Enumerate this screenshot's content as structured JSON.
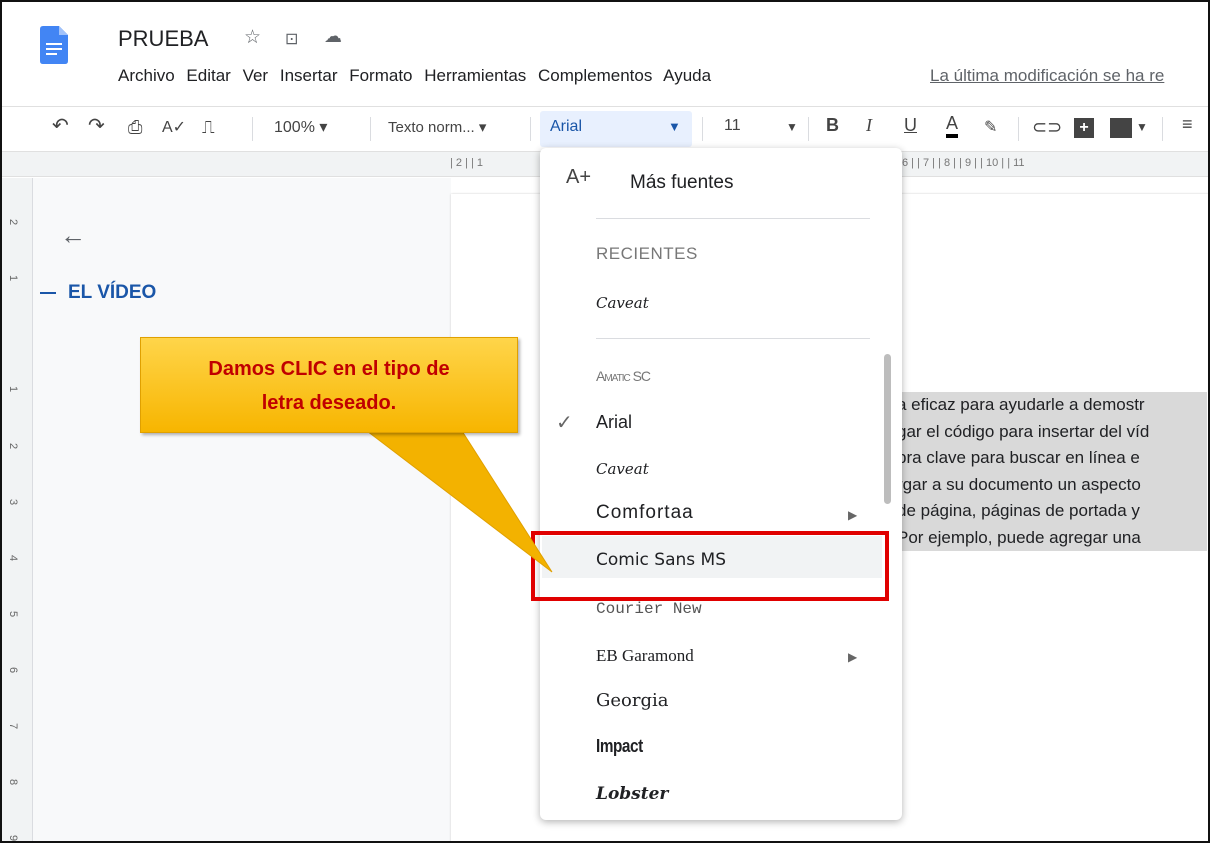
{
  "title_bar": {
    "doc_title": "PRUEBA"
  },
  "menu": {
    "items": [
      "Archivo",
      "Editar",
      "Ver",
      "Insertar",
      "Formato",
      "Herramientas",
      "Complementos",
      "Ayuda"
    ],
    "last_modified": "La última modificación se ha re"
  },
  "toolbar": {
    "zoom": "100%",
    "style": "Texto norm...",
    "font": "Arial",
    "size": "11",
    "bold": "B",
    "italic": "I",
    "underline": "U",
    "textcolor": "A"
  },
  "ruler": {
    "h_left": "| 2 | | 1",
    "h_right": "6 | | 7 | | 8 | | 9 | | 10 | | 11",
    "v_numbers": [
      "2",
      "1",
      "1",
      "2",
      "3",
      "4",
      "5",
      "6",
      "7",
      "8",
      "9"
    ]
  },
  "outline": {
    "back_icon": "arrow-left-icon",
    "heading": "EL VÍDEO"
  },
  "dropdown": {
    "more_fonts": "Más fuentes",
    "recent_header": "RECIENTES",
    "recent": [
      "Caveat"
    ],
    "fonts": [
      "Amatic SC",
      "Arial",
      "Caveat",
      "Comfortaa",
      "Comic Sans MS",
      "Courier New",
      "EB Garamond",
      "Georgia",
      "Impact",
      "Lobster"
    ],
    "selected": "Arial",
    "highlighted": "Comic Sans MS"
  },
  "doc_text": [
    "a eficaz para ayudarle a demostr",
    "gar el código para insertar del víd",
    "bra clave para buscar en línea e",
    "rgar a su documento un aspecto",
    "de página, páginas de portada y",
    "Por ejemplo, puede agregar una"
  ],
  "callout": {
    "line1": "Damos CLIC en el tipo de",
    "line2": "letra deseado."
  },
  "colors": {
    "accent": "#1a56a8",
    "callout": "#f7b500",
    "highlight_box": "#e00000"
  }
}
